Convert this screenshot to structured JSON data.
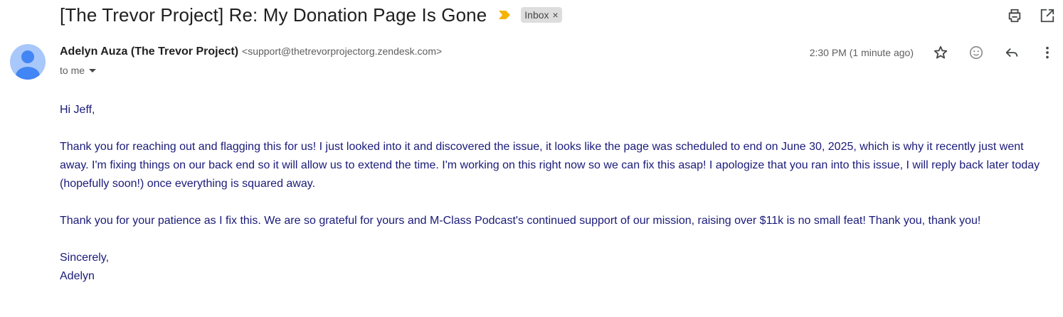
{
  "subject": {
    "title": "[The Trevor Project] Re: My Donation Page Is Gone",
    "label": "Inbox",
    "label_remove": "×"
  },
  "sender": {
    "name": "Adelyn Auza (The Trevor Project)",
    "email": "<support@thetrevorprojectorg.zendesk.com>",
    "to": "to me",
    "timestamp": "2:30 PM (1 minute ago)"
  },
  "body": {
    "greeting": "Hi Jeff,",
    "paragraph1": "Thank you for reaching out and flagging this for us! I just looked into it and discovered the issue, it looks like the page was scheduled to end on June 30, 2025, which is why it recently just went away. I'm fixing things on our back end so it will allow us to extend the time. I'm working on this right now so we can fix this asap! I apologize that you ran into this issue, I will reply back later today (hopefully soon!) once everything is squared away.",
    "paragraph2": "Thank you for your patience as I fix this. We are so grateful for yours and M-Class Podcast's continued support of our mission, raising over $11k is no small feat! Thank you, thank you!",
    "signoff": "Sincerely,",
    "signature": "Adelyn"
  },
  "colors": {
    "importance_marker": "#f4b400",
    "body_text": "#1a1a7a",
    "avatar_bg": "#a8c7fa",
    "avatar_fg": "#4285f4"
  },
  "icons": {
    "top": [
      "print-icon",
      "open-in-new-window-icon"
    ],
    "message": [
      "star-icon",
      "emoji-reaction-icon",
      "reply-icon",
      "more-vert-icon"
    ]
  }
}
